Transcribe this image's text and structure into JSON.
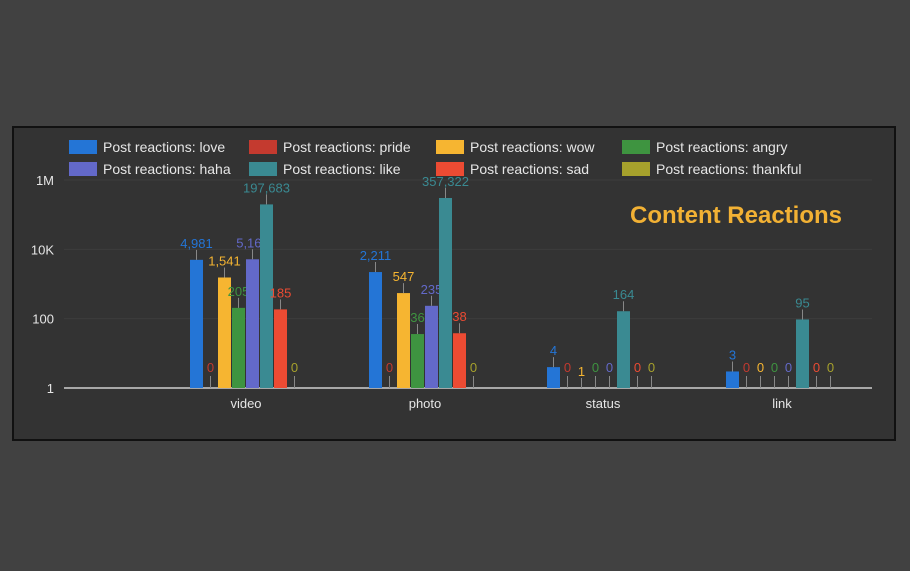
{
  "chart_data": {
    "type": "bar",
    "title": "Content Reactions",
    "yscale": "log",
    "ylim": [
      1,
      1000000
    ],
    "ytick_labels": [
      "1",
      "100",
      "10K",
      "1M"
    ],
    "yticks": [
      1,
      100,
      10000,
      1000000
    ],
    "categories": [
      "video",
      "photo",
      "status",
      "link"
    ],
    "series": [
      {
        "name": "Post reactions: love",
        "color": "#2475d6",
        "values": [
          4981,
          2211,
          4,
          3
        ],
        "labels": [
          "4,981",
          "2,211",
          "4",
          "3"
        ]
      },
      {
        "name": "Post reactions: pride",
        "color": "#c43a2f",
        "values": [
          0,
          0,
          0,
          0
        ],
        "labels": [
          "0",
          "0",
          "0",
          "0"
        ]
      },
      {
        "name": "Post reactions: wow",
        "color": "#f6b531",
        "values": [
          1541,
          547,
          1,
          0
        ],
        "labels": [
          "1,541",
          "547",
          "1",
          "0"
        ]
      },
      {
        "name": "Post reactions: angry",
        "color": "#3e9440",
        "values": [
          205,
          36,
          0,
          0
        ],
        "labels": [
          "205",
          "36",
          "0",
          "0"
        ]
      },
      {
        "name": "Post reactions: haha",
        "color": "#6369c9",
        "values": [
          5162,
          235,
          0,
          0
        ],
        "labels": [
          "5,162",
          "235",
          "0",
          "0"
        ]
      },
      {
        "name": "Post reactions: like",
        "color": "#3a8a92",
        "values": [
          197683,
          357322,
          164,
          95
        ],
        "labels": [
          "197,683",
          "357,322",
          "164",
          "95"
        ]
      },
      {
        "name": "Post reactions: sad",
        "color": "#ec4b33",
        "values": [
          185,
          38,
          0,
          0
        ],
        "labels": [
          "185",
          "38",
          "0",
          "0"
        ]
      },
      {
        "name": "Post reactions: thankful",
        "color": "#a6a12c",
        "values": [
          0,
          0,
          0,
          0
        ],
        "labels": [
          "0",
          "0",
          "0",
          "0"
        ]
      }
    ],
    "legend_position": "top"
  }
}
